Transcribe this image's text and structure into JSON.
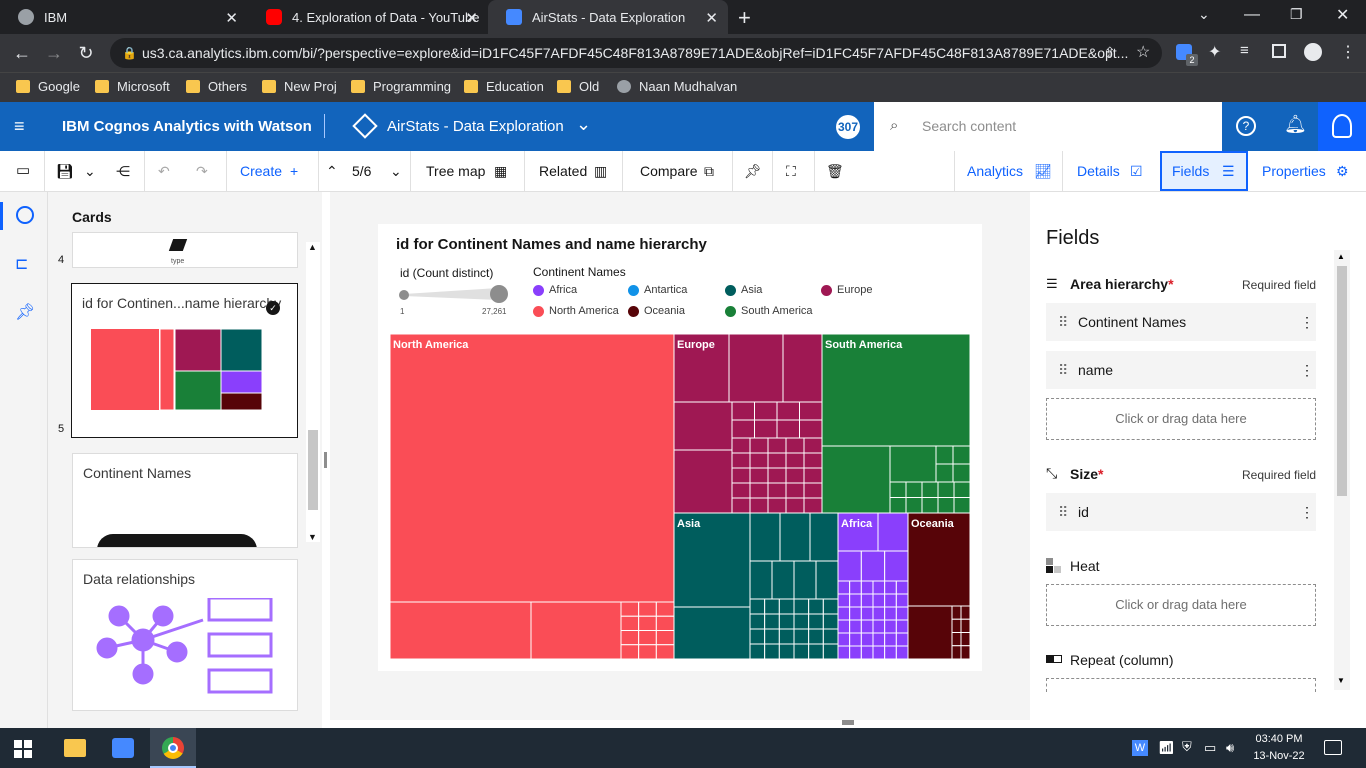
{
  "browser": {
    "tabs": [
      {
        "title": "IBM"
      },
      {
        "title": "4. Exploration of Data - YouTube"
      },
      {
        "title": "AirStats - Data Exploration"
      }
    ],
    "url": "us3.ca.analytics.ibm.com/bi/?perspective=explore&id=iD1FC45F7AFDF45C48F813A8789E71ADE&objRef=iD1FC45F7AFDF45C48F813A8789E71ADE&opt...",
    "bookmarks": [
      "Google",
      "Microsoft",
      "Others",
      "New Proj",
      "Programming",
      "Education",
      "Old",
      "Naan Mudhalvan"
    ],
    "ext_badge": "2"
  },
  "app": {
    "product": "IBM Cognos Analytics with Watson",
    "doc_title": "AirStats - Data Exploration",
    "badge": "307",
    "search_placeholder": "Search content"
  },
  "toolbar": {
    "create": "Create",
    "page": "5/6",
    "viz_type": "Tree map",
    "related": "Related",
    "compare": "Compare",
    "analytics": "Analytics",
    "details": "Details",
    "fields": "Fields",
    "properties": "Properties"
  },
  "cards": {
    "title": "Cards",
    "items": [
      {
        "index": "4",
        "caption": "type"
      },
      {
        "index": "5",
        "title": "id for Continen...name hierarchy"
      },
      {
        "title": "Continent Names"
      },
      {
        "title": "Data relationships"
      }
    ]
  },
  "chart_data": {
    "type": "heatmap",
    "subtype": "treemap",
    "title": "id for Continent Names and name hierarchy",
    "size_legend": {
      "label": "id (Count distinct)",
      "min": "1",
      "max": "27,261"
    },
    "legend_title": "Continent Names",
    "legend": [
      {
        "name": "Africa",
        "color": "#8a3ffc"
      },
      {
        "name": "Antartica",
        "color": "#1192e8"
      },
      {
        "name": "Asia",
        "color": "#005d5d"
      },
      {
        "name": "Europe",
        "color": "#9f1853"
      },
      {
        "name": "North America",
        "color": "#fa4d56"
      },
      {
        "name": "Oceania",
        "color": "#570408"
      },
      {
        "name": "South America",
        "color": "#198038"
      }
    ],
    "shown_labels": [
      "North America",
      "Europe",
      "South America",
      "Asia",
      "Africa",
      "Oceania"
    ]
  },
  "fields_panel": {
    "title": "Fields",
    "area_label": "Area hierarchy",
    "required": "Required field",
    "area_fields": [
      "Continent Names",
      "name"
    ],
    "drop_text": "Click or drag data here",
    "size_label": "Size",
    "size_field": "id",
    "heat_label": "Heat",
    "repeat_label": "Repeat (column)"
  },
  "taskbar": {
    "time": "03:40 PM",
    "date": "13-Nov-22"
  }
}
